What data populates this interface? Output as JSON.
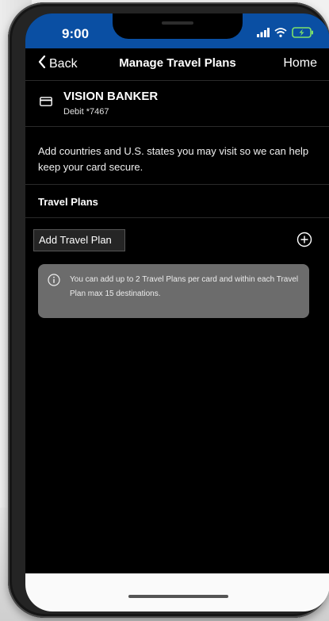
{
  "status_bar": {
    "time": "9:00",
    "icons": [
      "signal-icon",
      "wifi-icon",
      "battery-icon"
    ],
    "background_color": "#0a4fa3"
  },
  "nav": {
    "back_label": "Back",
    "title": "Manage Travel Plans",
    "home_label": "Home"
  },
  "card": {
    "name": "VISION BANKER",
    "detail": "Debit *7467",
    "icon": "credit-card-icon"
  },
  "info_text": "Add countries and U.S. states you may visit so we can help keep your card secure.",
  "travel_plans": {
    "section_title": "Travel Plans",
    "add_label": "Add Travel Plan",
    "add_icon": "plus-circle-icon"
  },
  "notice": {
    "icon": "info-icon",
    "text": "You can add up to 2 Travel Plans per card and within each Travel Plan max 15 destinations."
  }
}
